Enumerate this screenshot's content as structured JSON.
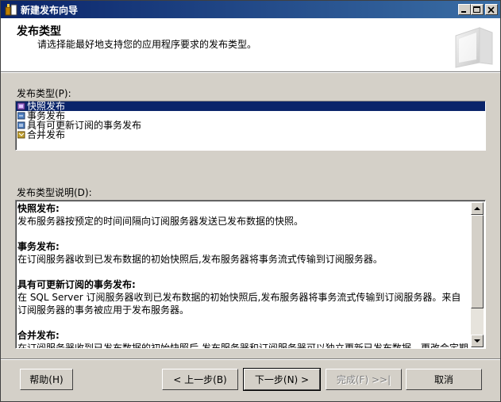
{
  "window": {
    "title": "新建发布向导",
    "controls": [
      "minimize-icon",
      "maximize-icon",
      "close-icon"
    ]
  },
  "header": {
    "title": "发布类型",
    "subtitle": "请选择能最好地支持您的应用程序要求的发布类型。"
  },
  "publication_types": {
    "label": "发布类型(P):",
    "items": [
      {
        "label": "快照发布",
        "icon": "snapshot-publication-icon",
        "selected": true
      },
      {
        "label": "事务发布",
        "icon": "transactional-publication-icon",
        "selected": false
      },
      {
        "label": "具有可更新订阅的事务发布",
        "icon": "updatable-subscription-icon",
        "selected": false
      },
      {
        "label": "合并发布",
        "icon": "merge-publication-icon",
        "selected": false
      }
    ]
  },
  "description": {
    "label": "发布类型说明(D):",
    "blocks": [
      {
        "heading": "快照发布:",
        "text": "发布服务器按预定的时间间隔向订阅服务器发送已发布数据的快照。"
      },
      {
        "heading": "事务发布:",
        "text": "在订阅服务器收到已发布数据的初始快照后,发布服务器将事务流式传输到订阅服务器。"
      },
      {
        "heading": "具有可更新订阅的事务发布:",
        "text": "在 SQL Server 订阅服务器收到已发布数据的初始快照后,发布服务器将事务流式传输到订阅服务器。来自订阅服务器的事务被应用于发布服务器。"
      },
      {
        "heading": "合并发布:",
        "text": "在订阅服务器收到已发布数据的初始快照后,发布服务器和订阅服务器可以独立更新已发布数据。更改会定期合并。"
      }
    ]
  },
  "buttons": {
    "help": "帮助(H)",
    "back": "< 上一步(B)",
    "next": "下一步(N) >",
    "finish": "完成(F) >>|",
    "cancel": "取消"
  }
}
